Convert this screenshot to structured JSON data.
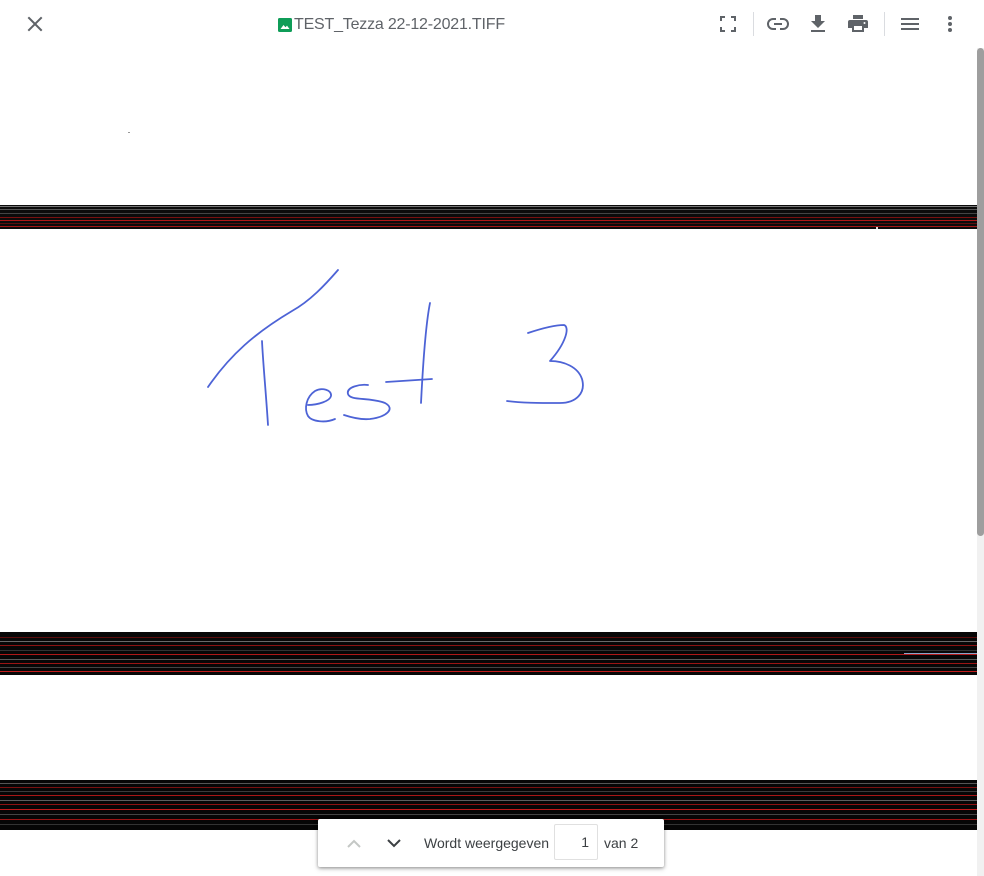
{
  "toolbar": {
    "file_name": "TEST_Tezza 22-12-2021.TIFF",
    "file_type_icon": "image-icon",
    "file_icon_color": "#0f9d58",
    "icons": {
      "close": "close-icon",
      "fullscreen": "fullscreen-icon",
      "link": "link-icon",
      "download": "download-icon",
      "print": "print-icon",
      "details": "menu-icon",
      "more": "more-vert-icon"
    }
  },
  "document": {
    "handwriting": "Test 3",
    "ink_color": "#4d63d6"
  },
  "pager": {
    "prev_icon": "chevron-up-icon",
    "next_icon": "chevron-down-icon",
    "showing_label": "Wordt weergegeven",
    "current_page": "1",
    "of_label": "van 2"
  }
}
